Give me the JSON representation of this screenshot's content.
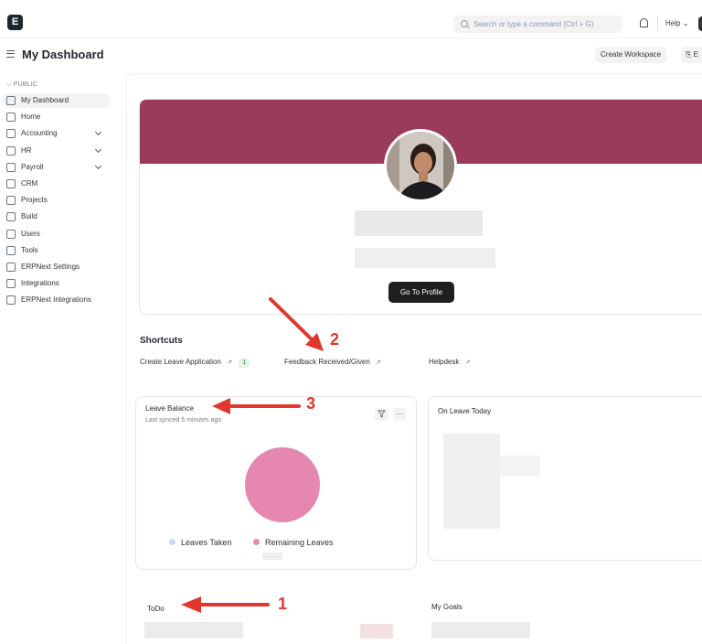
{
  "navbar": {
    "logo": "E",
    "search_placeholder": "Search or type a command (Ctrl + G)",
    "help_label": "Help",
    "help_chevron": "⌄"
  },
  "header": {
    "title": "My Dashboard",
    "create_workspace_label": "Create Workspace",
    "edit_label": "⎘ E"
  },
  "sidebar": {
    "section_label": "PUBLIC",
    "items": [
      {
        "label": "My Dashboard",
        "icon": "dashboard-icon",
        "active": true,
        "has_chevron": false
      },
      {
        "label": "Home",
        "icon": "home-icon",
        "active": false,
        "has_chevron": false
      },
      {
        "label": "Accounting",
        "icon": "accounting-icon",
        "active": false,
        "has_chevron": true
      },
      {
        "label": "HR",
        "icon": "hr-icon",
        "active": false,
        "has_chevron": true
      },
      {
        "label": "Payroll",
        "icon": "payroll-icon",
        "active": false,
        "has_chevron": true
      },
      {
        "label": "CRM",
        "icon": "crm-icon",
        "active": false,
        "has_chevron": false
      },
      {
        "label": "Projects",
        "icon": "projects-icon",
        "active": false,
        "has_chevron": false
      },
      {
        "label": "Build",
        "icon": "build-icon",
        "active": false,
        "has_chevron": false
      },
      {
        "label": "Users",
        "icon": "users-icon",
        "active": false,
        "has_chevron": false
      },
      {
        "label": "Tools",
        "icon": "tools-icon",
        "active": false,
        "has_chevron": false
      },
      {
        "label": "ERPNext Settings",
        "icon": "settings-icon",
        "active": false,
        "has_chevron": false
      },
      {
        "label": "Integrations",
        "icon": "integrations-icon",
        "active": false,
        "has_chevron": false
      },
      {
        "label": "ERPNext Integrations",
        "icon": "integrations-icon",
        "active": false,
        "has_chevron": false
      }
    ]
  },
  "profile": {
    "banner_color": "#9b3b5c",
    "button_label": "Go To Profile"
  },
  "shortcuts": {
    "title": "Shortcuts",
    "items": [
      {
        "label": "Create Leave Application",
        "arrow": "↗",
        "count": "1"
      },
      {
        "label": "Feedback Received/Given",
        "arrow": "↗"
      },
      {
        "label": "Helpdesk",
        "arrow": "↗"
      }
    ]
  },
  "leave_balance": {
    "title": "Leave Balance",
    "subtitle": "Last synced 5 minutes ago",
    "filter_icon": "filter-icon",
    "more_label": "···",
    "legend": [
      {
        "label": "Leaves Taken",
        "color": "#c9dcf0"
      },
      {
        "label": "Remaining Leaves",
        "color": "#e587ae"
      }
    ]
  },
  "on_leave_today": {
    "title": "On Leave Today"
  },
  "todo": {
    "title": "ToDo"
  },
  "goals": {
    "title": "My Goals"
  },
  "annotations": {
    "color": "#e1372e",
    "numbers": [
      "1",
      "2",
      "3"
    ]
  }
}
